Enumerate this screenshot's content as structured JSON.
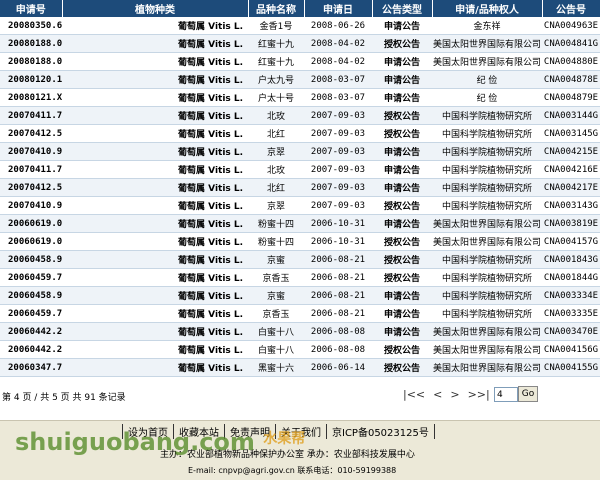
{
  "table": {
    "headers": [
      "申请号",
      "植物种类",
      "品种名称",
      "申请日",
      "公告类型",
      "申请/品种权人",
      "公告号"
    ],
    "rows": [
      [
        "20080350.6",
        "葡萄属 Vitis L.",
        "金香1号",
        "2008-06-26",
        "申请公告",
        "金东祥",
        "CNA004963E"
      ],
      [
        "20080188.0",
        "葡萄属 Vitis L.",
        "红蜜十九",
        "2008-04-02",
        "授权公告",
        "美国太阳世界国际有限公司",
        "CNA004841G"
      ],
      [
        "20080188.0",
        "葡萄属 Vitis L.",
        "红蜜十九",
        "2008-04-02",
        "申请公告",
        "美国太阳世界国际有限公司",
        "CNA004880E"
      ],
      [
        "20080120.1",
        "葡萄属 Vitis L.",
        "户太九号",
        "2008-03-07",
        "申请公告",
        "纪  俭",
        "CNA004878E"
      ],
      [
        "20080121.X",
        "葡萄属 Vitis L.",
        "户太十号",
        "2008-03-07",
        "申请公告",
        "纪  俭",
        "CNA004879E"
      ],
      [
        "20070411.7",
        "葡萄属 Vitis L.",
        "北玫",
        "2007-09-03",
        "授权公告",
        "中国科学院植物研究所",
        "CNA003144G"
      ],
      [
        "20070412.5",
        "葡萄属 Vitis L.",
        "北红",
        "2007-09-03",
        "授权公告",
        "中国科学院植物研究所",
        "CNA003145G"
      ],
      [
        "20070410.9",
        "葡萄属 Vitis L.",
        "京翠",
        "2007-09-03",
        "申请公告",
        "中国科学院植物研究所",
        "CNA004215E"
      ],
      [
        "20070411.7",
        "葡萄属 Vitis L.",
        "北玫",
        "2007-09-03",
        "申请公告",
        "中国科学院植物研究所",
        "CNA004216E"
      ],
      [
        "20070412.5",
        "葡萄属 Vitis L.",
        "北红",
        "2007-09-03",
        "申请公告",
        "中国科学院植物研究所",
        "CNA004217E"
      ],
      [
        "20070410.9",
        "葡萄属 Vitis L.",
        "京翠",
        "2007-09-03",
        "授权公告",
        "中国科学院植物研究所",
        "CNA003143G"
      ],
      [
        "20060619.0",
        "葡萄属 Vitis L.",
        "粉蜜十四",
        "2006-10-31",
        "申请公告",
        "美国太阳世界国际有限公司",
        "CNA003819E"
      ],
      [
        "20060619.0",
        "葡萄属 Vitis L.",
        "粉蜜十四",
        "2006-10-31",
        "授权公告",
        "美国太阳世界国际有限公司",
        "CNA004157G"
      ],
      [
        "20060458.9",
        "葡萄属 Vitis L.",
        "京蜜",
        "2006-08-21",
        "授权公告",
        "中国科学院植物研究所",
        "CNA001843G"
      ],
      [
        "20060459.7",
        "葡萄属 Vitis L.",
        "京香玉",
        "2006-08-21",
        "授权公告",
        "中国科学院植物研究所",
        "CNA001844G"
      ],
      [
        "20060458.9",
        "葡萄属 Vitis L.",
        "京蜜",
        "2006-08-21",
        "申请公告",
        "中国科学院植物研究所",
        "CNA003334E"
      ],
      [
        "20060459.7",
        "葡萄属 Vitis L.",
        "京香玉",
        "2006-08-21",
        "申请公告",
        "中国科学院植物研究所",
        "CNA003335E"
      ],
      [
        "20060442.2",
        "葡萄属 Vitis L.",
        "白蜜十八",
        "2006-08-08",
        "申请公告",
        "美国太阳世界国际有限公司",
        "CNA003470E"
      ],
      [
        "20060442.2",
        "葡萄属 Vitis L.",
        "白蜜十八",
        "2006-08-08",
        "授权公告",
        "美国太阳世界国际有限公司",
        "CNA004156G"
      ],
      [
        "20060347.7",
        "葡萄属 Vitis L.",
        "黑蜜十六",
        "2006-06-14",
        "授权公告",
        "美国太阳世界国际有限公司",
        "CNA004155G"
      ]
    ]
  },
  "pager": {
    "summary": "第 4 页 / 共 5 页 共 91 条记录",
    "first": "|<<",
    "prev": "<",
    "next": ">",
    "last": ">>|",
    "page_input": "4",
    "go_label": "Go"
  },
  "footer": {
    "links": [
      "设为首页",
      "收藏本站",
      "免责声明",
      "关于我们",
      "京ICP备05023125号"
    ],
    "line2": "主办：农业部植物新品种保护办公室    承办：农业部科技发展中心",
    "line3": "E-mail: cnpvp@agri.gov.cn      联系电话：010-59199388"
  },
  "watermark": {
    "text": "shuiguobang",
    "suffix": ".com",
    "cn": "水果帮"
  }
}
